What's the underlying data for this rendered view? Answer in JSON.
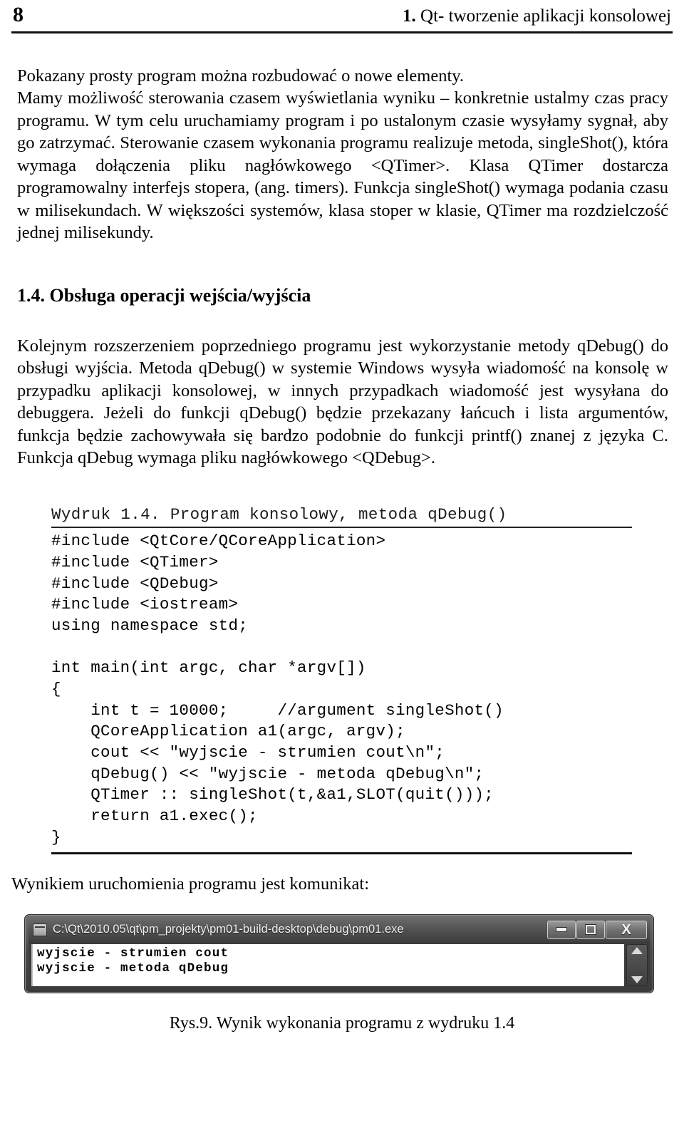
{
  "header": {
    "page_number": "8",
    "chapter_number": "1.",
    "chapter_title": "Qt- tworzenie aplikacji konsolowej"
  },
  "body": {
    "paragraph_1_line_1": "Pokazany prosty program można rozbudować o nowe elementy.",
    "paragraph_1_rest": "Mamy możliwość sterowania czasem wyświetlania wyniku – konkretnie ustalmy czas pracy programu. W tym celu uruchamiamy program i po ustalonym czasie wysyłamy sygnał, aby go zatrzymać. Sterowanie czasem wykonania programu realizuje metoda, singleShot(), która wymaga dołączenia pliku nagłówkowego <QTimer>. Klasa QTimer dostarcza programowalny interfejs stopera, (ang. timers). Funkcja singleShot() wymaga podania czasu w milisekundach. W większości systemów, klasa stoper w klasie, QTimer ma rozdzielczość jednej milisekundy."
  },
  "section": {
    "heading": "1.4. Obsługa operacji wejścia/wyjścia",
    "paragraph": "Kolejnym rozszerzeniem poprzedniego programu jest wykorzystanie metody qDebug() do obsługi wyjścia. Metoda qDebug() w systemie Windows wysyła wiadomość na konsolę w przypadku aplikacji konsolowej, w innych przypadkach wiadomość jest wysyłana do debuggera. Jeżeli do funkcji qDebug() będzie przekazany łańcuch i lista argumentów, funkcja będzie zachowywała się bardzo podobnie do funkcji printf() znanej z języka C. Funkcja qDebug wymaga pliku nagłówkowego <QDebug>."
  },
  "listing": {
    "caption": "Wydruk 1.4. Program konsolowy, metoda qDebug()",
    "lines": [
      "#include <QtCore/QCoreApplication>",
      "#include <QTimer>",
      "#include <QDebug>",
      "#include <iostream>",
      "using namespace std;",
      "",
      "int main(int argc, char *argv[])",
      "{",
      "    int t = 10000;     //argument singleShot()",
      "    QCoreApplication a1(argc, argv);",
      "    cout << \"wyjscie - strumien cout\\n\";",
      "    qDebug() << \"wyjscie - metoda qDebug\\n\";",
      "    QTimer :: singleShot(t,&a1,SLOT(quit()));",
      "    return a1.exec();",
      "}"
    ]
  },
  "after_listing_text": "Wynikiem uruchomienia programu jest komunikat:",
  "console": {
    "title": "C:\\Qt\\2010.05\\qt\\pm_projekty\\pm01-build-desktop\\debug\\pm01.exe",
    "buttons": {
      "minimize": "minimize",
      "maximize": "maximize",
      "close": "X"
    },
    "output": "wyjscie - strumien cout\nwyjscie - metoda qDebug"
  },
  "figure_caption": "Rys.9. Wynik wykonania programu z wydruku 1.4"
}
